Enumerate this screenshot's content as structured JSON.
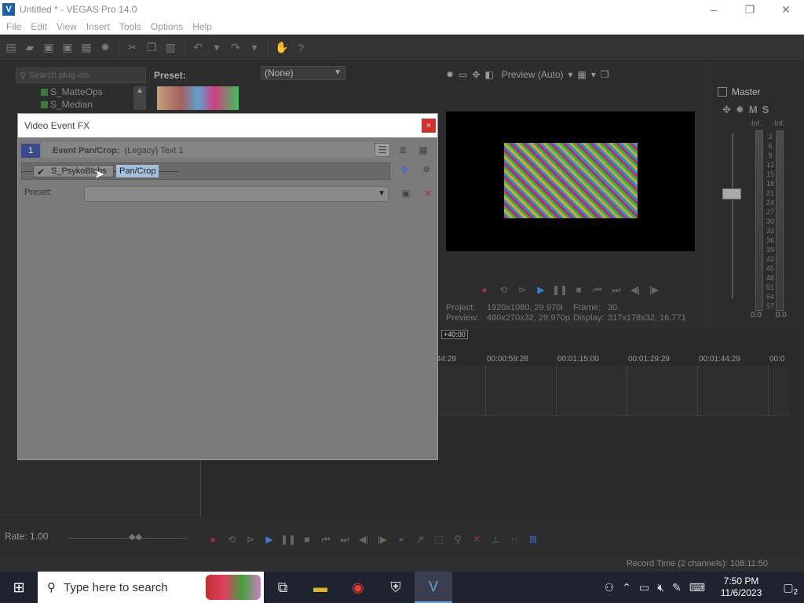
{
  "window": {
    "title": "Untitled * - VEGAS Pro 14.0",
    "logo": "V",
    "controls": [
      "–",
      "❐",
      "✕"
    ]
  },
  "menu": [
    "File",
    "Edit",
    "View",
    "Insert",
    "Tools",
    "Options",
    "Help"
  ],
  "plugins": {
    "search_placeholder": "Search plug-ins",
    "preset_label": "Preset:",
    "items": [
      "S_MatteOps",
      "S_Median"
    ]
  },
  "transition_select": {
    "value": "(None)"
  },
  "preview": {
    "quality": "Preview (Auto)",
    "project_label": "Project:",
    "project_value": "1920x1080, 29.970i",
    "frame_label": "Frame:",
    "frame_value": "30",
    "preview_label": "Preview:",
    "preview_value": "480x270x32, 29.970p",
    "display_label": "Display:",
    "display_value": "317x178x32, 16.771"
  },
  "master": {
    "label": "Master",
    "buttons": [
      "M",
      "S"
    ],
    "inf_left": "-Inf.",
    "inf_right": "-Inf.",
    "scale": [
      "3",
      "6",
      "9",
      "12",
      "15",
      "18",
      "21",
      "24",
      "27",
      "30",
      "33",
      "36",
      "39",
      "42",
      "45",
      "48",
      "51",
      "54",
      "57"
    ],
    "bottom_left": "0.0",
    "bottom_right": "0.0"
  },
  "timeline": {
    "marker": "+40:00",
    "ticks": [
      "44:29",
      "00:00:59:28",
      "00:01:15:00",
      "00:01:29:29",
      "00:01:44:29",
      "00:0"
    ]
  },
  "bottom": {
    "rate": "Rate: 1.00",
    "record_time": "Record Time (2 channels): 108:11:50"
  },
  "dialog": {
    "title": "Video Event FX",
    "close": "×",
    "badge": "1",
    "event_title": "Event Pan/Crop:",
    "event_sub": "(Legacy) Text 1",
    "fx1": "S_PsykoBlobs",
    "fx2": "Pan/Crop",
    "preset_label": "Preset:"
  },
  "taskbar": {
    "search_placeholder": "Type here to search",
    "time": "7:50 PM",
    "date": "11/6/2023",
    "notifications": "2"
  }
}
